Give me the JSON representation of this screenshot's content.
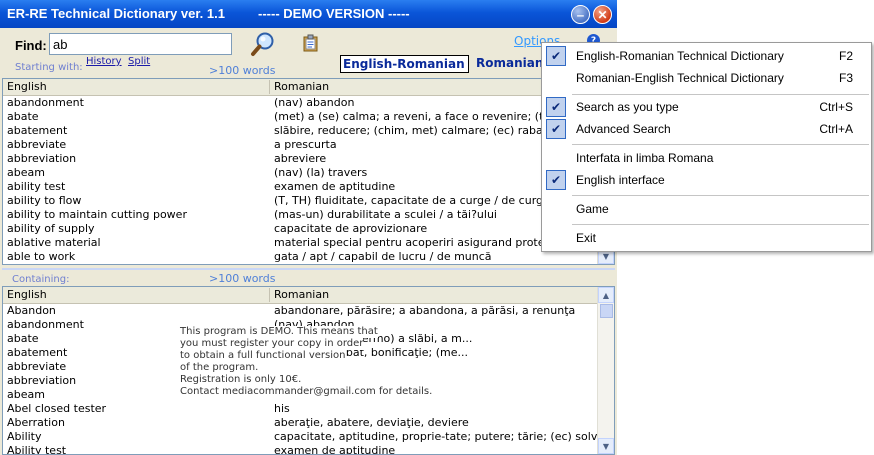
{
  "window": {
    "title": "ER-RE Technical Dictionary ver. 1.1",
    "demo_title": "----- DEMO VERSION -----"
  },
  "colors": {
    "accent": "#0a55d8",
    "link": "#1a1aa8",
    "menu_check_bg": "#c1d2ee"
  },
  "search": {
    "find_label": "Find:",
    "value": "ab",
    "search_icon": "magnifier-icon",
    "clipboard_icon": "clipboard-icon"
  },
  "toolbar": {
    "starting_with_label": "Starting with:",
    "history_link": "History",
    "split_link": "Split",
    "count_top": ">100 words",
    "count_bottom": ">100 words",
    "direction_label": "English-Romanian",
    "direction_label_2": "Romanian",
    "options_link": "Options",
    "help_icon": "?"
  },
  "list_top": {
    "headers": [
      "English",
      "Romanian"
    ],
    "rows": [
      [
        "abandonment",
        "(nav) abandon"
      ],
      [
        "abate",
        "(met) a (se) calma; a reveni, a face o revenire; (termo) a s"
      ],
      [
        "abatement",
        "slăbire, reducere; (chim, met) calmare; (ec) rabat, bonifica"
      ],
      [
        "abbreviate",
        "a prescurta"
      ],
      [
        "abbreviation",
        "abreviere"
      ],
      [
        "abeam",
        "(nav) (la) travers"
      ],
      [
        "ability test",
        "examen de aptitudine"
      ],
      [
        "ability to flow",
        "(T, TH) fluiditate, capacitate de a curge / de curgere"
      ],
      [
        "ability to maintain cutting power",
        "(mas-un) durabilitate a sculei / a tăi?ului"
      ],
      [
        "ability of supply",
        "capacitate de aprovizionare"
      ],
      [
        "ablative material",
        "material special pentru acoperiri asigurand protecţie term"
      ],
      [
        "able to work",
        "gata / apt / capabil de lucru / de muncă"
      ]
    ]
  },
  "containing_label": "Containing:",
  "list_bottom": {
    "headers": [
      "English",
      "Romanian"
    ],
    "rows": [
      [
        "Abandon",
        "abandonare, părăsire; a abandona, a părăsi, a renunţa"
      ],
      [
        "abandonment",
        "(nav) abandon"
      ],
      [
        "abate",
        "ce o revenire; (termo) a slăbi, a m..."
      ],
      [
        "abatement",
        "mare; (ec) rabat, bonificaţie; (me..."
      ],
      [
        "abbreviate",
        ""
      ],
      [
        "abbreviation",
        ""
      ],
      [
        "abeam",
        ""
      ],
      [
        "Abel closed tester",
        "his"
      ],
      [
        "Aberration",
        "aberaţie, abatere, deviaţie, deviere"
      ],
      [
        "Ability",
        "capacitate, aptitudine, proprie-tate; putere; tărie; (ec) solvabilitate"
      ],
      [
        "Ability test",
        "examen de aptitudine"
      ]
    ]
  },
  "demo_notice": {
    "lines": [
      "This program is DEMO. This means that",
      "you must register your copy in order",
      "to obtain a full functional version",
      "of the program.",
      "Registration is only 10€.",
      "Contact mediacommander@gmail.com for details."
    ]
  },
  "options_menu": {
    "items": [
      {
        "label": "English-Romanian Technical Dictionary",
        "shortcut": "F2",
        "checked": true
      },
      {
        "label": "Romanian-English Technical Dictionary",
        "shortcut": "F3",
        "checked": false
      },
      {
        "label": "Search as you type",
        "shortcut": "Ctrl+S",
        "checked": true
      },
      {
        "label": "Advanced Search",
        "shortcut": "Ctrl+A",
        "checked": true
      },
      {
        "label": "Interfata in limba Romana",
        "shortcut": "",
        "checked": false
      },
      {
        "label": "English interface",
        "shortcut": "",
        "checked": true
      },
      {
        "label": "Game",
        "shortcut": "",
        "checked": false
      },
      {
        "label": "Exit",
        "shortcut": "",
        "checked": false
      }
    ]
  }
}
